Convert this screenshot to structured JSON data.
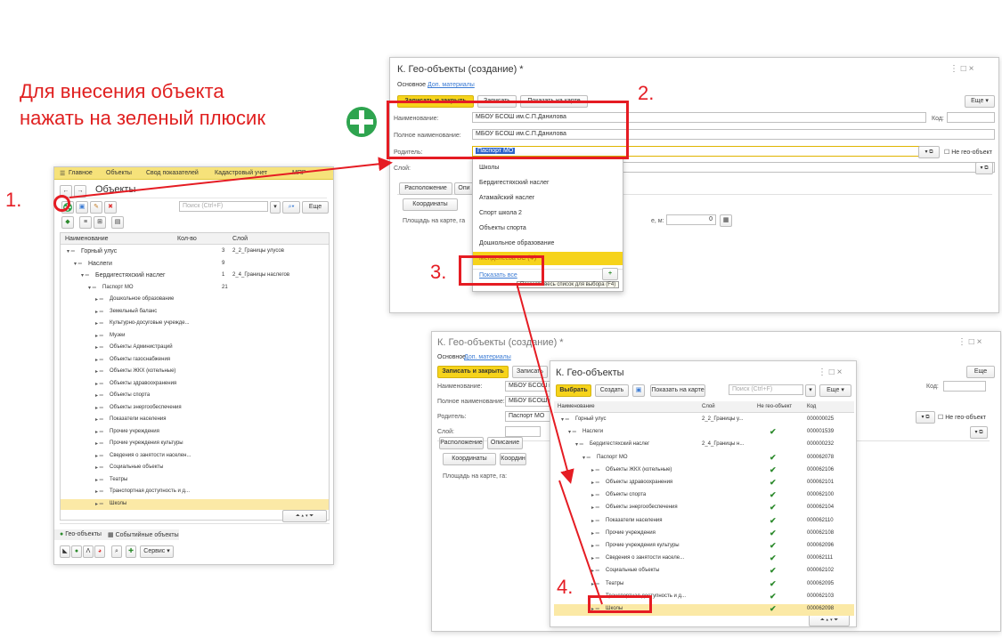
{
  "instruction": {
    "line1": "Для внесения объекта",
    "line2": "нажать на зеленый плюсик"
  },
  "steps": [
    "1.",
    "2.",
    "3.",
    "4."
  ],
  "main_window": {
    "nav": [
      "Главное",
      "Объекты",
      "Свод показателей",
      "Кадастровый учет",
      "МПР"
    ],
    "title": "Объекты",
    "search_placeholder": "Поиск (Ctrl+F)",
    "more_label": "Еще",
    "columns": [
      "Наименование",
      "Кол-во",
      "Слой"
    ],
    "rows": [
      {
        "name": "Горный улус",
        "count": "3",
        "layer": "2_2_Границы улусов"
      },
      {
        "name": "Наслеги",
        "count": "9",
        "layer": ""
      },
      {
        "name": "Бердигестяхский наслег",
        "count": "1",
        "layer": "2_4_Границы наслегов"
      },
      {
        "name": "Паспорт МО",
        "count": "21",
        "layer": ""
      },
      {
        "name": "Дошкольное образование",
        "count": "",
        "layer": ""
      },
      {
        "name": "Земельный баланс",
        "count": "",
        "layer": ""
      },
      {
        "name": "Культурно-досуговые учрежде...",
        "count": "",
        "layer": ""
      },
      {
        "name": "Музеи",
        "count": "",
        "layer": ""
      },
      {
        "name": "Объекты Администраций",
        "count": "",
        "layer": ""
      },
      {
        "name": "Объекты газоснабжения",
        "count": "",
        "layer": ""
      },
      {
        "name": "Объекты ЖКХ (котельные)",
        "count": "",
        "layer": ""
      },
      {
        "name": "Объекты здравоохранения",
        "count": "",
        "layer": ""
      },
      {
        "name": "Объекты спорта",
        "count": "",
        "layer": ""
      },
      {
        "name": "Объекты энергообеспечения",
        "count": "",
        "layer": ""
      },
      {
        "name": "Показатели населения",
        "count": "",
        "layer": ""
      },
      {
        "name": "Прочие учреждения",
        "count": "",
        "layer": ""
      },
      {
        "name": "Прочие учреждения культуры",
        "count": "",
        "layer": ""
      },
      {
        "name": "Сведения о занятости населен...",
        "count": "",
        "layer": ""
      },
      {
        "name": "Социальные объекты",
        "count": "",
        "layer": ""
      },
      {
        "name": "Театры",
        "count": "",
        "layer": ""
      },
      {
        "name": "Транспортная доступность и д...",
        "count": "",
        "layer": ""
      },
      {
        "name": "Школы",
        "count": "",
        "layer": ""
      }
    ],
    "bottom_tabs": [
      "Гео-объекты",
      "Событийные объекты"
    ],
    "service_label": "Сервис"
  },
  "create_window": {
    "title": "К. Гео-объекты (создание) *",
    "tabs": [
      "Основное",
      "Доп. материалы"
    ],
    "buttons": [
      "Записать и закрыть",
      "Записать",
      "Показать на карте"
    ],
    "more_label": "Еще",
    "name_label": "Наименование:",
    "name_value": "МБОУ БСОШ им.С.П.Данилова",
    "code_label": "Код:",
    "fullname_label": "Полное наименование:",
    "fullname_value": "МБОУ БСОШ им.С.П.Данилова",
    "parent_label": "Родитель:",
    "parent_value": "Паспорт МО",
    "not_geo_label": "Не гео-объект",
    "layer_label": "Слой:",
    "inner_tabs": [
      "Расположение",
      "Опи"
    ],
    "coords_button": "Координаты",
    "area_label": "Площадь на карте, га",
    "area2_label": "е, м:",
    "area2_value": "0",
    "dropdown_items": [
      "Школы",
      "Бердигестяхский наслег",
      "Атамайский наслег",
      "Спорт школа 2",
      "Объекты спорта",
      "Дошкольное образование",
      "Менделеева БС (Ф)"
    ],
    "show_all_label": "Показать все",
    "tooltip": "Показать весь список для выбора (F4)"
  },
  "back_window": {
    "title": "К. Гео-объекты (создание) *",
    "tabs": [
      "Основное",
      "Доп. материалы"
    ],
    "buttons": [
      "Записать и закрыть",
      "Записать"
    ],
    "more_label": "Еще",
    "name_label": "Наименование:",
    "name_value": "МБОУ БСОШ им",
    "code_label": "Код:",
    "fullname_label": "Полное наименование:",
    "fullname_value": "МБОУ БСОШ им",
    "parent_label": "Родитель:",
    "parent_value": "Паспорт МО",
    "not_geo_label": "Не гео-объект",
    "layer_label": "Слой:",
    "inner_tabs": [
      "Расположение",
      "Описание"
    ],
    "coords_buttons": [
      "Координаты",
      "Координ"
    ],
    "area_label": "Площадь на карте, га:"
  },
  "select_window": {
    "title": "К. Гео-объекты",
    "buttons": [
      "Выбрать",
      "Создать",
      "Показать на карте"
    ],
    "search_placeholder": "Поиск (Ctrl+F)",
    "more_label": "Еще",
    "columns": [
      "Наименование",
      "Слой",
      "Не гео-объект",
      "Код"
    ],
    "rows": [
      {
        "name": "Горный улус",
        "layer": "2_2_Границы у...",
        "check": "",
        "code": "000000025"
      },
      {
        "name": "Наслеги",
        "layer": "",
        "check": "✔",
        "code": "000001539"
      },
      {
        "name": "Бердигестяхский наслег",
        "layer": "2_4_Границы н...",
        "check": "",
        "code": "000000232"
      },
      {
        "name": "Паспорт МО",
        "layer": "",
        "check": "✔",
        "code": "000062078"
      },
      {
        "name": "Объекты ЖКХ (котельные)",
        "layer": "",
        "check": "✔",
        "code": "000062106"
      },
      {
        "name": "Объекты здравоохранения",
        "layer": "",
        "check": "✔",
        "code": "000062101"
      },
      {
        "name": "Объекты спорта",
        "layer": "",
        "check": "✔",
        "code": "000062100"
      },
      {
        "name": "Объекты энергообеспечения",
        "layer": "",
        "check": "✔",
        "code": "000062104"
      },
      {
        "name": "Показатели населения",
        "layer": "",
        "check": "✔",
        "code": "000062110"
      },
      {
        "name": "Прочие учреждения",
        "layer": "",
        "check": "✔",
        "code": "000062108"
      },
      {
        "name": "Прочие учреждения культуры",
        "layer": "",
        "check": "✔",
        "code": "000062096"
      },
      {
        "name": "Сведения о занятости населе...",
        "layer": "",
        "check": "✔",
        "code": "000062111"
      },
      {
        "name": "Социальные объекты",
        "layer": "",
        "check": "✔",
        "code": "000062102"
      },
      {
        "name": "Театры",
        "layer": "",
        "check": "✔",
        "code": "000062095"
      },
      {
        "name": "Транспортная доступность и д...",
        "layer": "",
        "check": "✔",
        "code": "000062103"
      },
      {
        "name": "Школы",
        "layer": "",
        "check": "✔",
        "code": "000062098"
      }
    ]
  },
  "colors": {
    "annotation_red": "#e51c23",
    "accent_yellow": "#f6d31b",
    "plus_green": "#2ea44f"
  }
}
